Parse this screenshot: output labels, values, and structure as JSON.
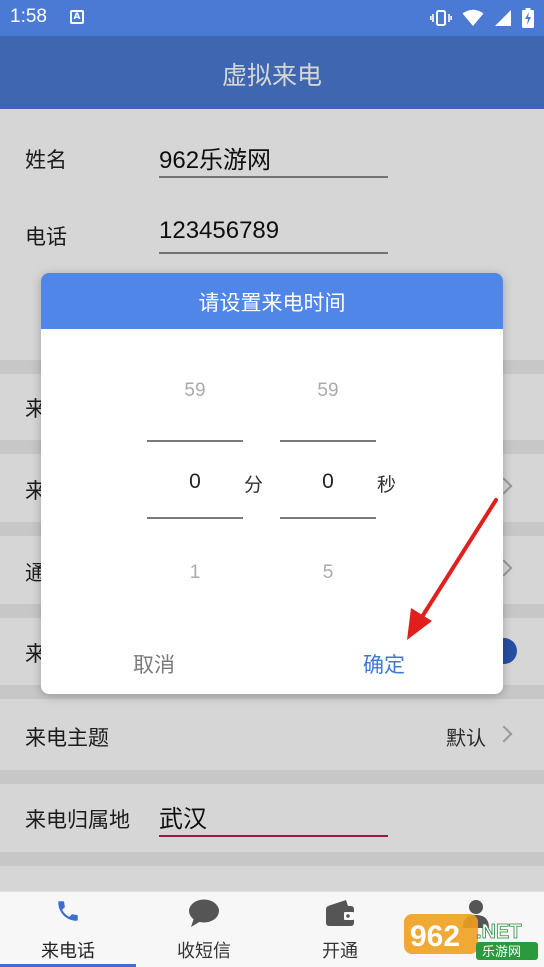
{
  "status_bar": {
    "time": "1:58",
    "a_badge": "A"
  },
  "app_bar": {
    "title": "虚拟来电"
  },
  "form": {
    "name_label": "姓名",
    "name_value": "962乐游网",
    "phone_label": "电话",
    "phone_value": "123456789",
    "row_clipped_1": "来",
    "row_clipped_2": "来",
    "row_clipped_3": "通",
    "row_clipped_4": "来",
    "theme_label": "来电主题",
    "theme_value": "默认",
    "location_label": "来电归属地",
    "location_value": "武汉"
  },
  "dialog": {
    "title": "请设置来电时间",
    "minutes": {
      "prev": "59",
      "selected": "0",
      "next": "1",
      "unit": "分"
    },
    "seconds": {
      "prev": "59",
      "selected": "0",
      "next": "5",
      "unit": "秒"
    },
    "cancel_label": "取消",
    "ok_label": "确定"
  },
  "bottom_nav": {
    "items": [
      {
        "label": "来电话",
        "icon": "phone-icon"
      },
      {
        "label": "收短信",
        "icon": "chat-bubble-icon"
      },
      {
        "label": "开通",
        "icon": "wallet-icon"
      },
      {
        "label": "",
        "icon": "person-icon"
      }
    ],
    "active_index": 0
  },
  "watermark": {
    "brand": "962.NET",
    "sub": "乐游网"
  },
  "colors": {
    "primary": "#4a7ad3",
    "dialog_header": "#4f86e8",
    "ok_button": "#3f79d6",
    "location_underline": "#c2185b",
    "annotation_arrow": "#e0201c"
  }
}
